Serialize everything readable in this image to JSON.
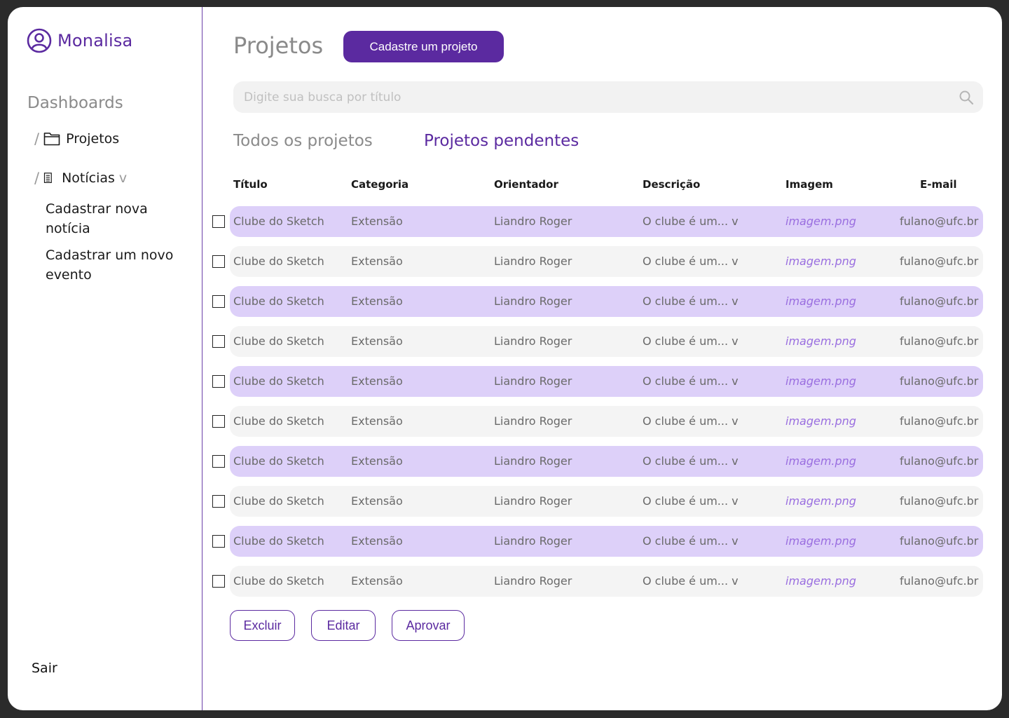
{
  "brand": {
    "name": "Monalisa"
  },
  "sidebar": {
    "section_title": "Dashboards",
    "items": [
      {
        "label": "Projetos",
        "icon": "folder-icon"
      },
      {
        "label": "Notícias",
        "icon": "document-icon",
        "caret": "v"
      }
    ],
    "subitems": [
      {
        "label": "Cadastrar nova notícia"
      },
      {
        "label": "Cadastrar um novo evento"
      }
    ],
    "logout": "Sair"
  },
  "main": {
    "title": "Projetos",
    "primary_button": "Cadastre um projeto",
    "search": {
      "placeholder": "Digite sua busca por título"
    },
    "tabs": [
      {
        "label": "Todos os projetos",
        "active": false
      },
      {
        "label": "Projetos pendentes",
        "active": true
      }
    ],
    "table": {
      "headers": [
        "Título",
        "Categoria",
        "Orientador",
        "Descrição",
        "Imagem",
        "E-mail"
      ],
      "rows": [
        {
          "titulo": "Clube do Sketch",
          "categoria": "Extensão",
          "orientador": "Liandro Roger",
          "descricao": "O clube é um... v",
          "imagem": "imagem.png",
          "email": "fulano@ufc.br"
        },
        {
          "titulo": "Clube do Sketch",
          "categoria": "Extensão",
          "orientador": "Liandro Roger",
          "descricao": "O clube é um... v",
          "imagem": "imagem.png",
          "email": "fulano@ufc.br"
        },
        {
          "titulo": "Clube do Sketch",
          "categoria": "Extensão",
          "orientador": "Liandro Roger",
          "descricao": "O clube é um... v",
          "imagem": "imagem.png",
          "email": "fulano@ufc.br"
        },
        {
          "titulo": "Clube do Sketch",
          "categoria": "Extensão",
          "orientador": "Liandro Roger",
          "descricao": "O clube é um... v",
          "imagem": "imagem.png",
          "email": "fulano@ufc.br"
        },
        {
          "titulo": "Clube do Sketch",
          "categoria": "Extensão",
          "orientador": "Liandro Roger",
          "descricao": "O clube é um... v",
          "imagem": "imagem.png",
          "email": "fulano@ufc.br"
        },
        {
          "titulo": "Clube do Sketch",
          "categoria": "Extensão",
          "orientador": "Liandro Roger",
          "descricao": "O clube é um... v",
          "imagem": "imagem.png",
          "email": "fulano@ufc.br"
        },
        {
          "titulo": "Clube do Sketch",
          "categoria": "Extensão",
          "orientador": "Liandro Roger",
          "descricao": "O clube é um... v",
          "imagem": "imagem.png",
          "email": "fulano@ufc.br"
        },
        {
          "titulo": "Clube do Sketch",
          "categoria": "Extensão",
          "orientador": "Liandro Roger",
          "descricao": "O clube é um... v",
          "imagem": "imagem.png",
          "email": "fulano@ufc.br"
        },
        {
          "titulo": "Clube do Sketch",
          "categoria": "Extensão",
          "orientador": "Liandro Roger",
          "descricao": "O clube é um... v",
          "imagem": "imagem.png",
          "email": "fulano@ufc.br"
        },
        {
          "titulo": "Clube do Sketch",
          "categoria": "Extensão",
          "orientador": "Liandro Roger",
          "descricao": "O clube é um... v",
          "imagem": "imagem.png",
          "email": "fulano@ufc.br"
        }
      ]
    },
    "actions": [
      "Excluir",
      "Editar",
      "Aprovar"
    ]
  },
  "colors": {
    "accent": "#5b2aa0",
    "row_highlight": "#ddd0f9",
    "row_plain": "#f4f4f4",
    "link": "#9a6ee0"
  }
}
